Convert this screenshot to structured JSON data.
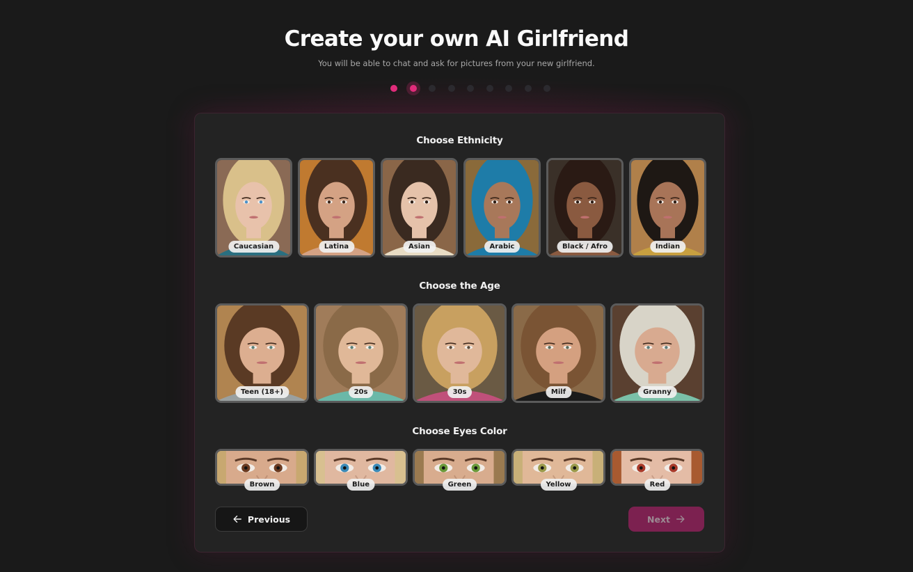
{
  "header": {
    "title": "Create your own AI Girlfriend",
    "subtitle": "You will be able to chat and ask for pictures from your new girlfriend."
  },
  "stepper": {
    "total": 9,
    "current": 2,
    "accent_color": "#e22d7c"
  },
  "sections": {
    "ethnicity": {
      "title": "Choose Ethnicity",
      "options": [
        {
          "label": "Caucasian",
          "bg": "#8a6a55",
          "skin": "#e8c2ab",
          "hair": "#d9c08a",
          "top": "#2a6f80",
          "eye": "#4a90c8"
        },
        {
          "label": "Latina",
          "bg": "#c07a30",
          "skin": "#d4a284",
          "hair": "#4a3020",
          "top": "#d4a284",
          "eye": "#3a2418"
        },
        {
          "label": "Asian",
          "bg": "#8a6648",
          "skin": "#e5c2aa",
          "hair": "#3a2a20",
          "top": "#e8dcc4",
          "eye": "#2a1a12"
        },
        {
          "label": "Arabic",
          "bg": "#8a6a3a",
          "skin": "#a8785a",
          "hair": "#1e7ca8",
          "top": "#1e7ca8",
          "eye": "#2a1a12"
        },
        {
          "label": "Black / Afro",
          "bg": "#3a3028",
          "skin": "#8a5a40",
          "hair": "#2a1a14",
          "top": "#8a5a40",
          "eye": "#2a1a12"
        },
        {
          "label": "Indian",
          "bg": "#b0804a",
          "skin": "#a87458",
          "hair": "#1e1814",
          "top": "#c8a040",
          "eye": "#2a1a12"
        }
      ]
    },
    "age": {
      "title": "Choose the Age",
      "options": [
        {
          "label": "Teen (18+)",
          "bg": "#b08450",
          "skin": "#dcae90",
          "hair": "#5a3a24",
          "top": "#9aa0a0",
          "eye": "#5a8078"
        },
        {
          "label": "20s",
          "bg": "#a07c5a",
          "skin": "#e0b898",
          "hair": "#8a6a48",
          "top": "#6ab8a8",
          "eye": "#5a8078"
        },
        {
          "label": "30s",
          "bg": "#6a5a44",
          "skin": "#e0b89a",
          "hair": "#c8a060",
          "top": "#c0507a",
          "eye": "#5a4a3a"
        },
        {
          "label": "Milf",
          "bg": "#8a6a48",
          "skin": "#d4a080",
          "hair": "#7a5434",
          "top": "#1a1a1a",
          "eye": "#5a6a5a"
        },
        {
          "label": "Granny",
          "bg": "#5a4030",
          "skin": "#d8aa90",
          "hair": "#d8d4c8",
          "top": "#7ac0a8",
          "eye": "#5a7a78"
        }
      ]
    },
    "eyes": {
      "title": "Choose Eyes Color",
      "options": [
        {
          "label": "Brown",
          "skin": "#d8aa8c",
          "hair": "#c8a870",
          "iris": "#6a3a20"
        },
        {
          "label": "Blue",
          "skin": "#e0b8a0",
          "hair": "#d8c090",
          "iris": "#3a8ab8"
        },
        {
          "label": "Green",
          "skin": "#d8ac8e",
          "hair": "#9a7a50",
          "iris": "#6a9a3a"
        },
        {
          "label": "Yellow",
          "skin": "#e0b898",
          "hair": "#c8b078",
          "iris": "#9a9a4a"
        },
        {
          "label": "Red",
          "skin": "#e4bca6",
          "hair": "#a85a30",
          "iris": "#a83a2a"
        }
      ]
    }
  },
  "footer": {
    "previous_label": "Previous",
    "next_label": "Next",
    "next_disabled": true
  }
}
